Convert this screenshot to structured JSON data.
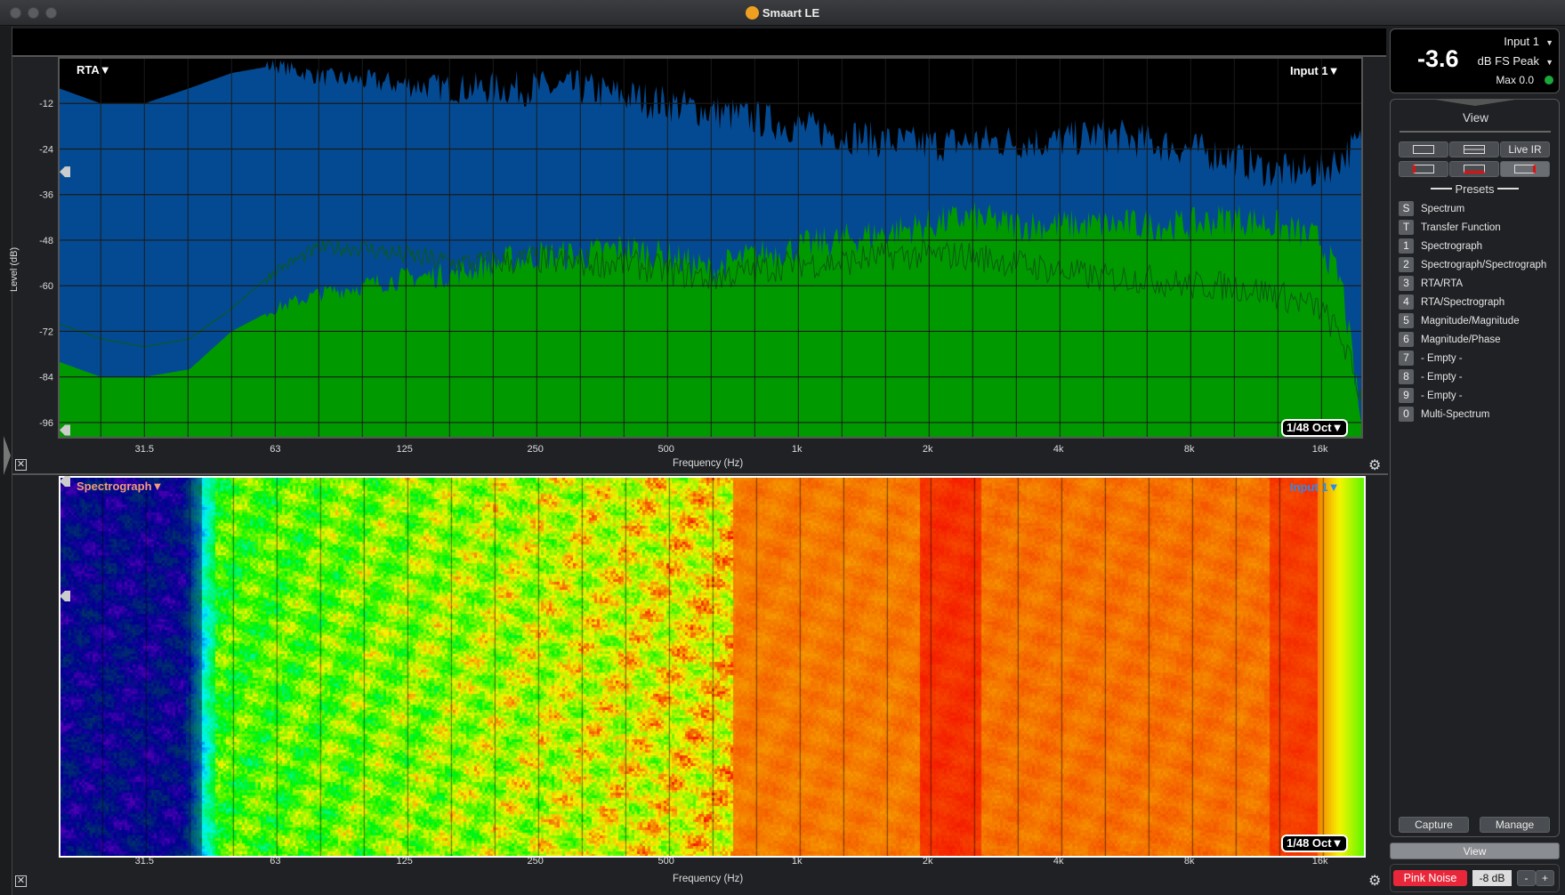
{
  "window": {
    "title": "Smaart LE"
  },
  "rta": {
    "mode_label": "RTA▼",
    "input_label": "Input 1▼",
    "resolution_label": "1/48 Oct▼",
    "ylabel": "Level (dB)",
    "xlabel": "Frequency (Hz)",
    "yticks": [
      "-12",
      "-24",
      "-36",
      "-48",
      "-60",
      "-72",
      "-84",
      "-96"
    ],
    "xticks": [
      "31.5",
      "63",
      "125",
      "250",
      "500",
      "1k",
      "2k",
      "4k",
      "8k",
      "16k"
    ]
  },
  "spectrograph": {
    "mode_label": "Spectrograph▼",
    "input_label": "Input 1▼",
    "resolution_label": "1/48 Oct▼",
    "xlabel": "Frequency (Hz)",
    "xticks": [
      "31.5",
      "63",
      "125",
      "250",
      "500",
      "1k",
      "2k",
      "4k",
      "8k",
      "16k"
    ]
  },
  "chart_data": {
    "type": "area",
    "xscale": "log",
    "xlim": [
      20,
      20000
    ],
    "ylim": [
      -100,
      0
    ],
    "grid": true,
    "x": [
      20,
      25,
      31.5,
      40,
      50,
      63,
      80,
      100,
      125,
      160,
      200,
      250,
      315,
      400,
      500,
      630,
      800,
      1000,
      1250,
      1600,
      2000,
      2500,
      3150,
      4000,
      5000,
      6300,
      8000,
      10000,
      12500,
      16000,
      18000,
      20000
    ],
    "series": [
      {
        "role": "peak-hold",
        "color": "#044a92",
        "values": [
          -8,
          -12,
          -12,
          -8,
          -4,
          -2,
          -5,
          -6,
          -7,
          -8,
          -8,
          -8,
          -8,
          -10,
          -12,
          -14,
          -16,
          -18,
          -20,
          -22,
          -23,
          -22,
          -22,
          -22,
          -20,
          -22,
          -24,
          -26,
          -30,
          -30,
          -26,
          -22
        ]
      },
      {
        "role": "live",
        "color": "#009a00",
        "values": [
          -80,
          -84,
          -84,
          -82,
          -72,
          -66,
          -62,
          -60,
          -58,
          -57,
          -54,
          -52,
          -52,
          -50,
          -52,
          -56,
          -52,
          -50,
          -48,
          -46,
          -44,
          -42,
          -44,
          -44,
          -44,
          -44,
          -44,
          -42,
          -44,
          -48,
          -60,
          -98
        ]
      },
      {
        "role": "average",
        "color": "#0b5a12",
        "values": [
          -70,
          -74,
          -76,
          -74,
          -66,
          -56,
          -50,
          -50,
          -52,
          -54,
          -54,
          -53,
          -54,
          -54,
          -56,
          -58,
          -56,
          -54,
          -54,
          -52,
          -52,
          -52,
          -54,
          -56,
          -58,
          -58,
          -60,
          -60,
          -62,
          -66,
          -74,
          -90
        ]
      }
    ]
  },
  "meter": {
    "value": "-3.6",
    "input": "Input 1",
    "unit": "dB FS Peak",
    "max": "Max 0.0",
    "status_color": "#1aa83a"
  },
  "view_panel": {
    "title": "View",
    "live_ir": "Live IR",
    "presets_title": "Presets",
    "presets": [
      {
        "key": "S",
        "label": "Spectrum"
      },
      {
        "key": "T",
        "label": "Transfer Function"
      },
      {
        "key": "1",
        "label": "Spectrograph"
      },
      {
        "key": "2",
        "label": "Spectrograph/Spectrograph"
      },
      {
        "key": "3",
        "label": "RTA/RTA"
      },
      {
        "key": "4",
        "label": "RTA/Spectrograph"
      },
      {
        "key": "5",
        "label": "Magnitude/Magnitude"
      },
      {
        "key": "6",
        "label": "Magnitude/Phase"
      },
      {
        "key": "7",
        "label": "- Empty -"
      },
      {
        "key": "8",
        "label": "- Empty -"
      },
      {
        "key": "9",
        "label": "- Empty -"
      },
      {
        "key": "0",
        "label": "Multi-Spectrum"
      }
    ],
    "capture": "Capture",
    "manage": "Manage",
    "view_button": "View"
  },
  "generator": {
    "label": "Pink Noise",
    "level": "-8 dB",
    "minus": "-",
    "plus": "+",
    "color": "#e8283a"
  }
}
